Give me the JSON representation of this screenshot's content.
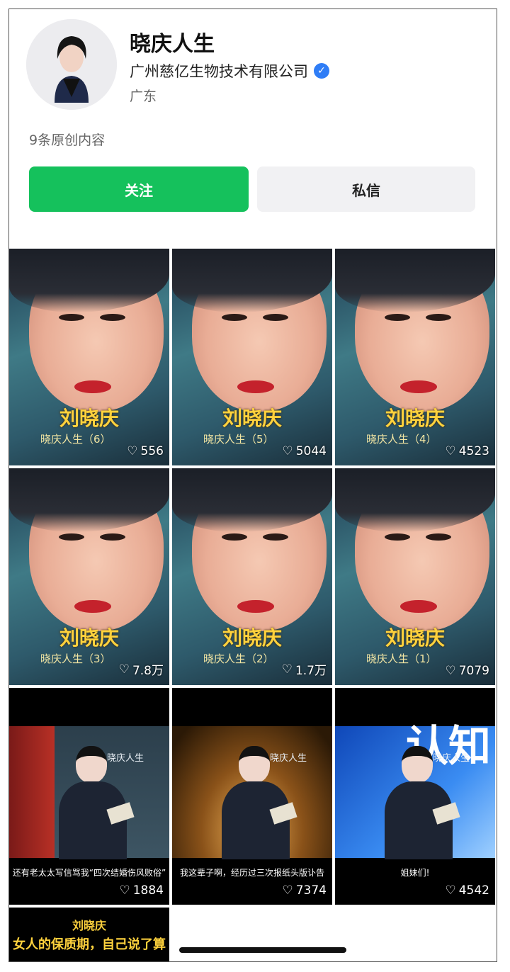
{
  "profile": {
    "name": "晓庆人生",
    "company": "广州慈亿生物技术有限公司",
    "verified_icon": "verified-badge-icon",
    "region": "广东",
    "count_text": "9条原创内容"
  },
  "actions": {
    "follow": "关注",
    "message": "私信"
  },
  "posts": [
    {
      "title": "刘晓庆",
      "subtitle": "晓庆人生（6）",
      "likes": "556"
    },
    {
      "title": "刘晓庆",
      "subtitle": "晓庆人生（5）",
      "likes": "5044"
    },
    {
      "title": "刘晓庆",
      "subtitle": "晓庆人生（4）",
      "likes": "4523"
    },
    {
      "title": "刘晓庆",
      "subtitle": "晓庆人生（3）",
      "likes": "7.8万"
    },
    {
      "title": "刘晓庆",
      "subtitle": "晓庆人生（2）",
      "likes": "1.7万"
    },
    {
      "title": "刘晓庆",
      "subtitle": "晓庆人生（1）",
      "likes": "7079"
    },
    {
      "tag": "晓庆人生",
      "caption": "还有老太太写信骂我“四次结婚伤风败俗”",
      "likes": "1884"
    },
    {
      "tag": "晓庆人生",
      "caption": "我这辈子啊，经历过三次报纸头版讣告",
      "likes": "7374"
    },
    {
      "tag": "晓庆人生",
      "bigtext": "认知",
      "caption": "姐妹们!",
      "likes": "4542"
    },
    {
      "line1": "刘晓庆",
      "line2": "女人的保质期，自己说了算"
    }
  ]
}
